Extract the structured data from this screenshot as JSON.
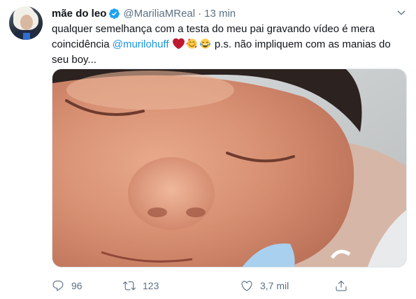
{
  "tweet": {
    "display_name": "mãe do leo",
    "handle": "@MariliaMReal",
    "separator": "·",
    "time": "13 min",
    "text": {
      "line_part1": "qualquer semelhança com a testa do meu pai gravando vídeo é mera coincidência ",
      "mention": "@murilohuff",
      "line_part2": " p.s. não impliquem com as manias do seu boy..."
    },
    "emojis": [
      "red-heart",
      "smiling-face-with-hearts",
      "face-with-tears-of-joy"
    ],
    "image": {
      "alt": ""
    },
    "actions": {
      "replies": "96",
      "retweets": "123",
      "likes": "3,7 mil"
    }
  },
  "colors": {
    "accent": "#1b95e0",
    "verified": "#1da1f2",
    "heart": "#e0245e",
    "muted": "#5b7083",
    "text": "#0f1419"
  },
  "icons": {
    "verified": "verified-badge-icon",
    "caret": "chevron-down-icon",
    "reply": "reply-icon",
    "retweet": "retweet-icon",
    "like": "heart-outline-icon",
    "share": "share-icon"
  }
}
